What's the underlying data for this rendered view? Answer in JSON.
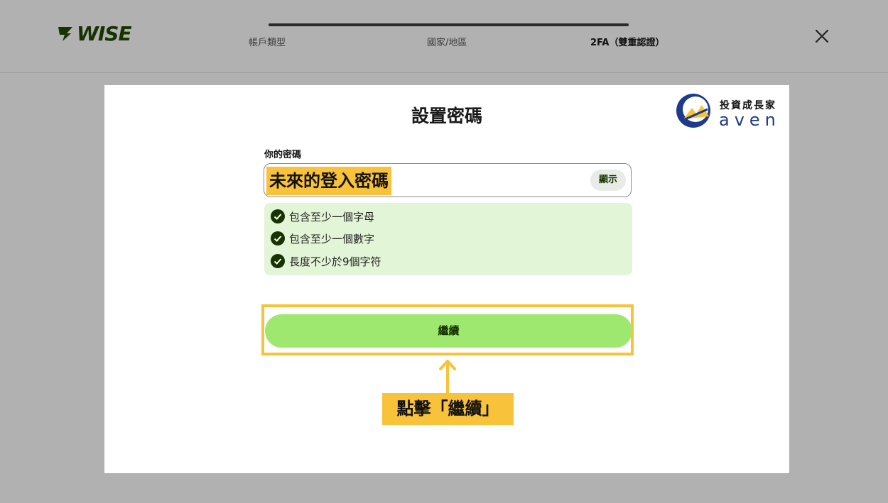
{
  "header": {
    "logo_text": "WISE",
    "steps": [
      {
        "label": "帳戶類型"
      },
      {
        "label": "國家/地區"
      },
      {
        "label": "2FA（雙重認證）"
      }
    ],
    "close_icon": "close-icon"
  },
  "card": {
    "title": "設置密碼",
    "brand": {
      "cn": "投資成長家",
      "en": "aven"
    },
    "password": {
      "label": "你的密碼",
      "value": "未來的登入密碼",
      "show_label": "顯示"
    },
    "rules": [
      {
        "text": "包含至少一個字母",
        "icon": "check-circle-icon"
      },
      {
        "text": "包含至少一個數字",
        "icon": "check-circle-icon"
      },
      {
        "text": "長度不少於9個字符",
        "icon": "check-circle-icon"
      }
    ],
    "continue_label": "繼續",
    "callout": "點擊「繼續」"
  },
  "colors": {
    "accent_green": "#9fe870",
    "dark_green": "#163300",
    "highlight_yellow": "#f8c33a",
    "rules_bg": "#e2f5d6"
  }
}
